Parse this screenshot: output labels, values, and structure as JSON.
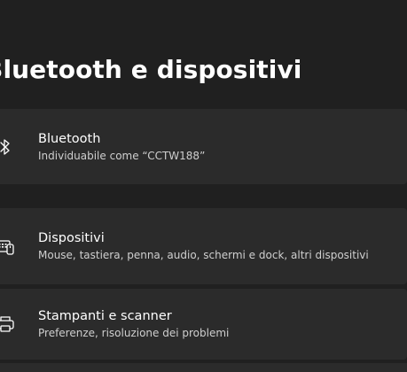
{
  "page": {
    "title": "Bluetooth e dispositivi"
  },
  "cards": {
    "bluetooth": {
      "icon": "bluetooth-icon",
      "title": "Bluetooth",
      "subtitle": "Individuabile come “CCTW188”"
    },
    "devices": {
      "icon": "devices-icon",
      "title": "Dispositivi",
      "subtitle": "Mouse, tastiera, penna, audio, schermi e dock, altri dispositivi"
    },
    "printers": {
      "icon": "printer-icon",
      "title": "Stampanti e scanner",
      "subtitle": "Preferenze, risoluzione dei problemi"
    }
  },
  "colors": {
    "background": "#202020",
    "card": "#2b2b2b",
    "text": "#ffffff",
    "subtext": "#cfcfcf"
  }
}
